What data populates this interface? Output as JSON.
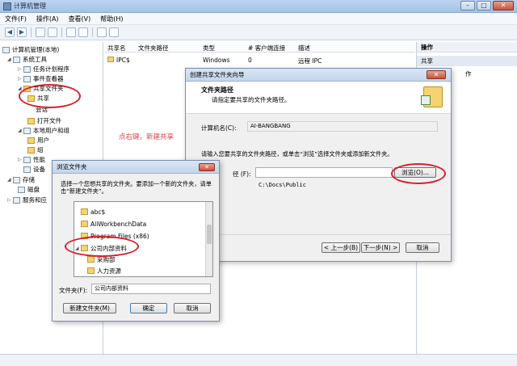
{
  "window": {
    "title": "计算机管理",
    "min": "–",
    "max": "□",
    "close": "✕"
  },
  "menu": [
    "文件(F)",
    "操作(A)",
    "查看(V)",
    "帮助(H)"
  ],
  "toolbar": {
    "back": "◀",
    "forward": "▶"
  },
  "tree": {
    "root": "计算机管理(本地)",
    "system_tools": "系统工具",
    "task_scheduler": "任务计划程序",
    "event_viewer": "事件查看器",
    "shared_folders": "共享文件夹",
    "shares": "共享",
    "sessions": "会话",
    "open_files": "打开文件",
    "local_users": "本地用户和组",
    "users": "用户",
    "groups": "组",
    "performance": "性能",
    "device_manager": "设备",
    "storage": "存储",
    "disk_mgmt": "磁盘",
    "services": "服务和应"
  },
  "list": {
    "columns": [
      "共享名",
      "文件夹路径",
      "类型",
      "# 客户端连接",
      "描述"
    ],
    "rows": [
      {
        "name": "IPC$",
        "path": "",
        "type": "Windows",
        "clients": "0",
        "desc": "远程 IPC"
      }
    ]
  },
  "actions": {
    "header": "操作",
    "sub": "共享",
    "more": "作"
  },
  "annotation": "点右键，新建共享",
  "wizard": {
    "title": "创建共享文件夹向导",
    "close": "✕",
    "heading": "文件夹路径",
    "subheading": "请指定要共享的文件夹路径。",
    "computer_label": "计算机名(C):",
    "computer_value": "AI-BANGBANG",
    "instruction": "请输入您要共享的文件夹路径，或单击“浏览”选择文件夹或添加新文件夹。",
    "path_label": "径 (F):",
    "browse": "浏览(O)...",
    "example": "C:\\Docs\\Public",
    "back": "< 上一步(B)",
    "next": "下一步(N) >",
    "cancel": "取消"
  },
  "browse": {
    "title": "浏览文件夹",
    "close": "✕",
    "instruction": "选择一个您想共享的文件夹。要添加一个新的文件夹，请单击“新建文件夹”。",
    "items": [
      "abc$",
      "AliWorkbenchData",
      "Program Files (x86)",
      "公司内部资料",
      "采购部",
      "人力资源"
    ],
    "folder_label": "文件夹(F):",
    "folder_value": "公司内部资料",
    "new_folder": "新建文件夹(M)",
    "ok": "确定",
    "cancel": "取消"
  },
  "colors": {
    "annotation": "#e04040",
    "ellipse": "#d6202a"
  }
}
